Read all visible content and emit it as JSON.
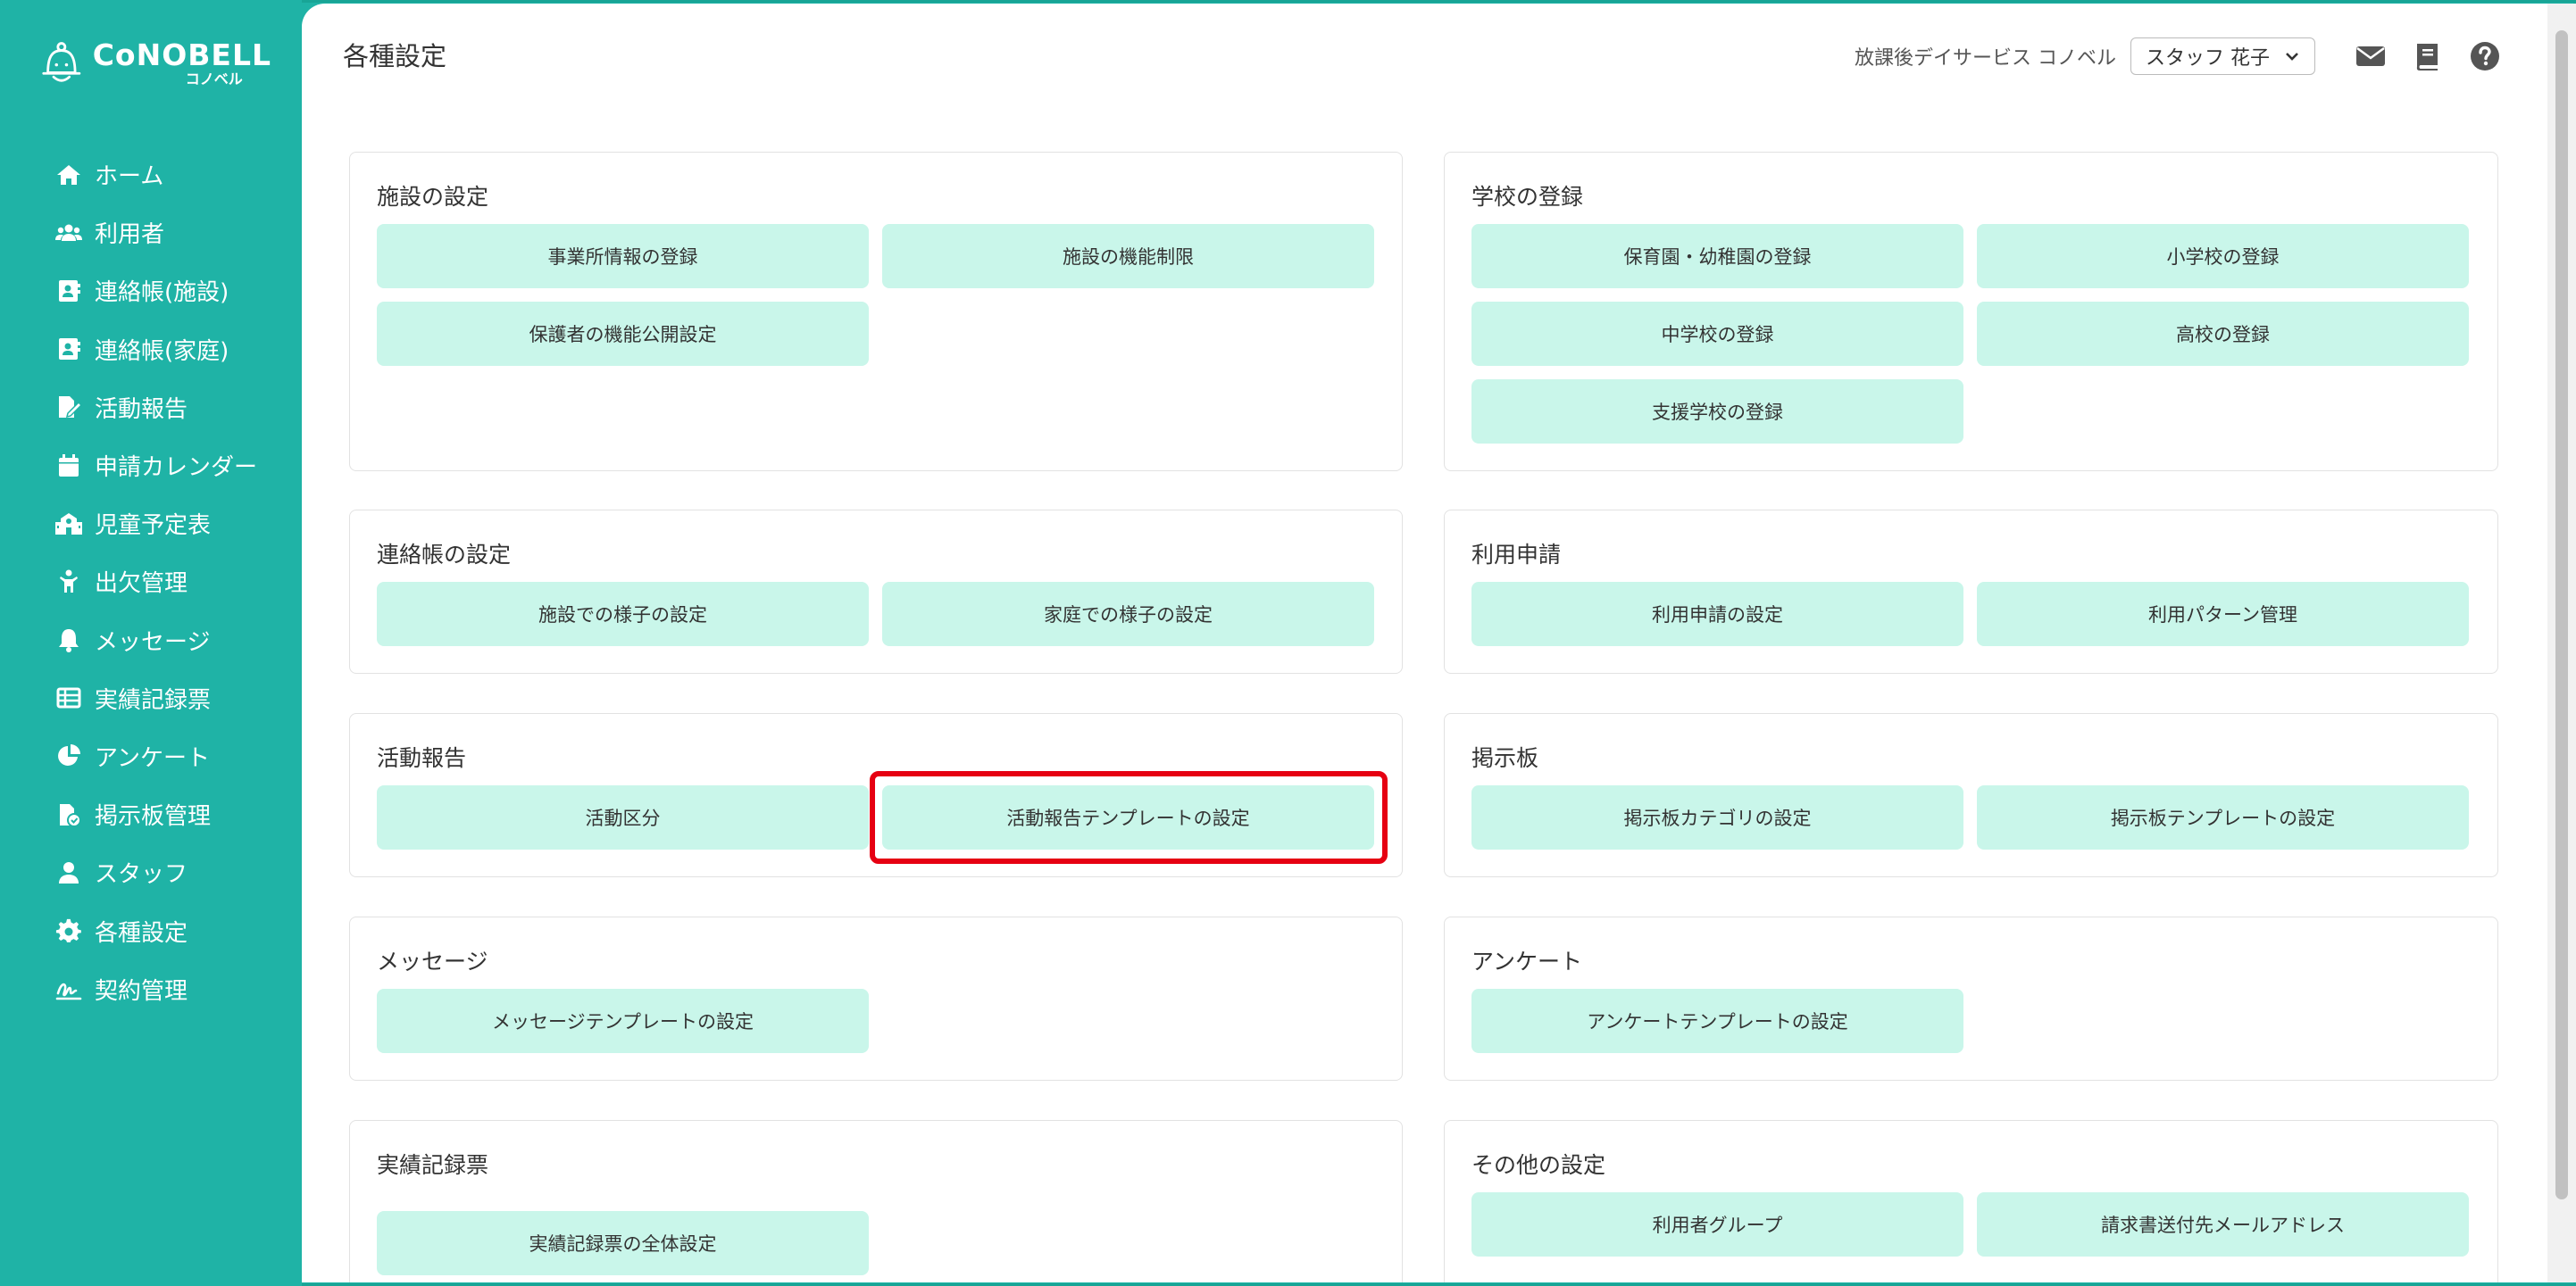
{
  "brand": {
    "name": "CoNOBELL",
    "sub": "コノベル"
  },
  "nav": [
    {
      "label": "ホーム",
      "icon": "home-icon"
    },
    {
      "label": "利用者",
      "icon": "users-icon"
    },
    {
      "label": "連絡帳(施設)",
      "icon": "contact-book-icon"
    },
    {
      "label": "連絡帳(家庭)",
      "icon": "contact-book-icon"
    },
    {
      "label": "活動報告",
      "icon": "report-edit-icon"
    },
    {
      "label": "申請カレンダー",
      "icon": "calendar-icon"
    },
    {
      "label": "児童予定表",
      "icon": "school-icon"
    },
    {
      "label": "出欠管理",
      "icon": "child-icon"
    },
    {
      "label": "メッセージ",
      "icon": "bell-icon"
    },
    {
      "label": "実績記録票",
      "icon": "table-icon"
    },
    {
      "label": "アンケート",
      "icon": "pie-chart-icon"
    },
    {
      "label": "掲示板管理",
      "icon": "bulletin-file-icon"
    },
    {
      "label": "スタッフ",
      "icon": "user-icon"
    },
    {
      "label": "各種設定",
      "icon": "gear-icon"
    },
    {
      "label": "契約管理",
      "icon": "signature-icon"
    }
  ],
  "header": {
    "title": "各種設定",
    "facility": "放課後デイサービス コノベル",
    "staff": "スタッフ 花子"
  },
  "sections": {
    "facility": {
      "title": "施設の設定",
      "buttons": [
        "事業所情報の登録",
        "施設の機能制限",
        "保護者の機能公開設定"
      ]
    },
    "school": {
      "title": "学校の登録",
      "buttons": [
        "保育園・幼稚園の登録",
        "小学校の登録",
        "中学校の登録",
        "高校の登録",
        "支援学校の登録"
      ]
    },
    "contact": {
      "title": "連絡帳の設定",
      "buttons": [
        "施設での様子の設定",
        "家庭での様子の設定"
      ]
    },
    "usage": {
      "title": "利用申請",
      "buttons": [
        "利用申請の設定",
        "利用パターン管理"
      ]
    },
    "activity": {
      "title": "活動報告",
      "buttons": [
        "活動区分",
        "活動報告テンプレートの設定"
      ]
    },
    "bulletin": {
      "title": "掲示板",
      "buttons": [
        "掲示板カテゴリの設定",
        "掲示板テンプレートの設定"
      ]
    },
    "message": {
      "title": "メッセージ",
      "buttons": [
        "メッセージテンプレートの設定"
      ]
    },
    "survey": {
      "title": "アンケート",
      "buttons": [
        "アンケートテンプレートの設定"
      ]
    },
    "record": {
      "title": "実績記録票",
      "buttons": [
        "実績記録票の全体設定"
      ]
    },
    "other": {
      "title": "その他の設定",
      "buttons": [
        "利用者グループ",
        "請求書送付先メールアドレス"
      ]
    }
  },
  "colors": {
    "brand": "#1fb3a6",
    "button_bg": "#c9f6ea",
    "highlight": "#e60012"
  }
}
